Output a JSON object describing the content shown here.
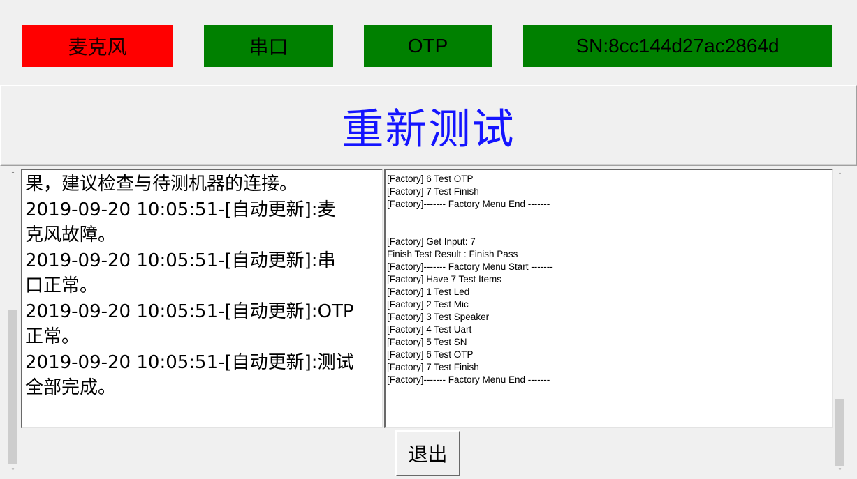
{
  "status_bar": {
    "mic": {
      "label": "麦克风",
      "color": "#ff0000"
    },
    "uart": {
      "label": "串口",
      "color": "#008000"
    },
    "otp": {
      "label": "OTP",
      "color": "#008000"
    },
    "sn": {
      "label": "SN:8cc144d27ac2864d",
      "color": "#008000"
    }
  },
  "retest_button": {
    "label": "重新测试",
    "color": "#1414ff"
  },
  "left_log": {
    "lines": [
      "果，建议检查与待测机器的连接。",
      "2019-09-20 10:05:51-[自动更新]:麦",
      "克风故障。",
      "2019-09-20 10:05:51-[自动更新]:串",
      "口正常。",
      "2019-09-20 10:05:51-[自动更新]:OTP",
      "正常。",
      "2019-09-20 10:05:51-[自动更新]:测试",
      "全部完成。"
    ]
  },
  "right_log": {
    "lines": [
      "[Factory] 6 Test OTP",
      "[Factory] 7 Test Finish",
      "[Factory]------- Factory Menu End -------",
      "",
      "",
      "[Factory] Get Input: 7",
      "Finish Test Result : Finish Pass",
      "[Factory]------- Factory Menu Start -------",
      "[Factory] Have 7 Test Items",
      "[Factory] 1 Test Led",
      "[Factory] 2 Test Mic",
      "[Factory] 3 Test Speaker",
      "[Factory] 4 Test Uart",
      "[Factory] 5 Test SN",
      "[Factory] 6 Test OTP",
      "[Factory] 7 Test Finish",
      "[Factory]------- Factory Menu End -------"
    ]
  },
  "exit_button": {
    "label": "退出"
  }
}
